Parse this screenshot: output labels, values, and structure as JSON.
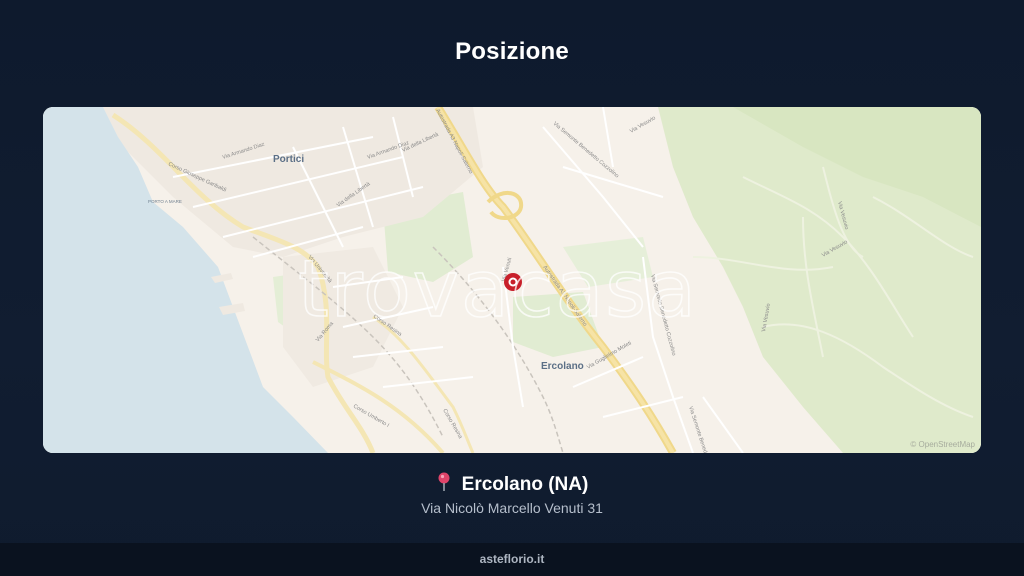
{
  "page": {
    "title": "Posizione"
  },
  "map": {
    "watermark": "trovacasa",
    "attribution": "© OpenStreetMap",
    "place_labels": {
      "portici": "Portici",
      "ercolano": "Ercolano",
      "porto": "PORTO A MARE"
    },
    "street_labels": {
      "garibaldi": "Corso Giuseppe Garibaldi",
      "diaz1": "Via Armando Diaz",
      "diaz2": "Via Armando Diaz",
      "liberta1": "Via della Libertà",
      "liberta2": "Via della Libertà",
      "univ": "Via Università",
      "resina": "Corso Resina",
      "roma": "Via Roma",
      "umberto": "Corso Umberto I",
      "resina2": "Corso Resina",
      "autostrada1": "Autostrada A3 Napoli-Salerno",
      "autostrada2": "Autostrada A3 Napoli-Salerno",
      "cozzolino1": "Via Semonte Benedetto Cozzolino",
      "cozzolino2": "Via Semonte Benedetto Cozzolino",
      "cozzolino3": "Via Semonte Benedetto Cozzolino",
      "vesuvio": "Via Vesuvio",
      "vesuvio2": "Via Vesuvio",
      "vesuvio3": "Via Vesuvio",
      "moleti": "Via Guglielmo Moleti",
      "venuti": "Via Venuti"
    },
    "marker_icon": "map-marker-icon"
  },
  "location": {
    "pin_icon": "pin-icon",
    "city": "Ercolano (NA)",
    "address": "Via Nicolò Marcello Venuti 31"
  },
  "footer": {
    "brand": "asteflorio.it"
  },
  "colors": {
    "background": "#0f1a2c",
    "sea": "#d4e3ea",
    "land": "#f6f1ea",
    "vegetation": "#dfeacb",
    "highway": "#f2dc9a",
    "marker": "#c8202b"
  }
}
